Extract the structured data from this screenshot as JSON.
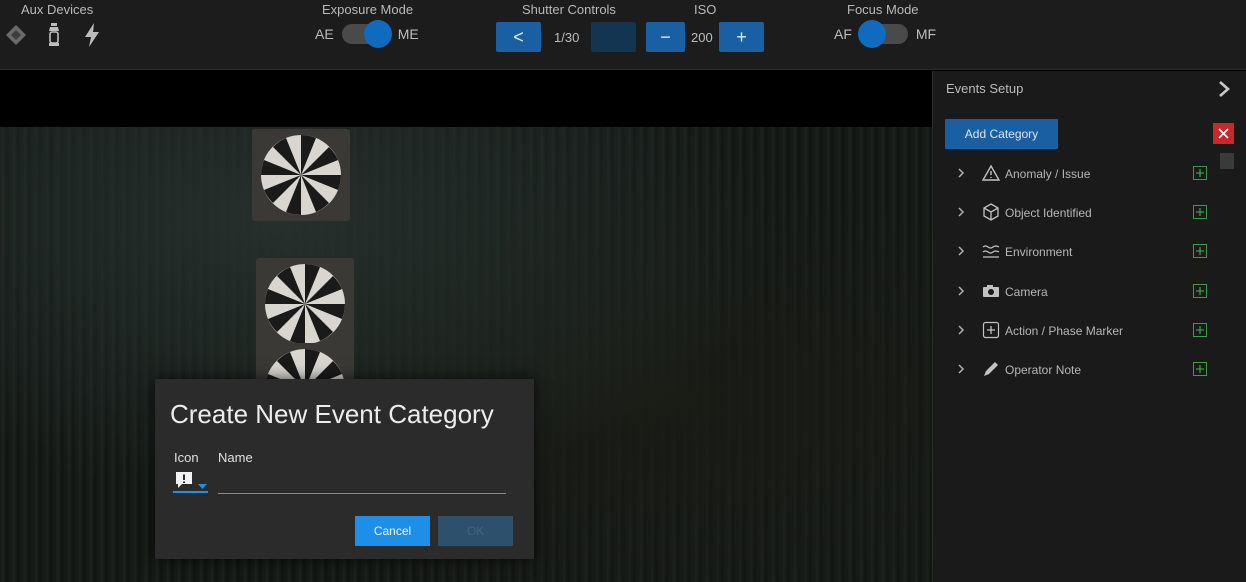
{
  "toolbar": {
    "aux_devices_label": "Aux Devices",
    "aux_icons": [
      "diamond-icon",
      "lantern-icon",
      "flash-icon"
    ],
    "exposure_mode": {
      "label": "Exposure Mode",
      "left": "AE",
      "right": "ME",
      "selected": "ME"
    },
    "shutter": {
      "label": "Shutter Controls",
      "prev": "<",
      "value": "1/30"
    },
    "iso": {
      "label": "ISO",
      "minus": "−",
      "value": "200",
      "plus": "+"
    },
    "focus_mode": {
      "label": "Focus Mode",
      "left": "AF",
      "right": "MF",
      "selected": "AF"
    }
  },
  "panel": {
    "title": "Events Setup",
    "add_category": "Add Category",
    "categories": [
      {
        "label": "Anomaly / Issue",
        "icon": "warning-triangle-icon"
      },
      {
        "label": "Object Identified",
        "icon": "cube-icon"
      },
      {
        "label": "Environment",
        "icon": "waves-icon"
      },
      {
        "label": "Camera",
        "icon": "camera-icon"
      },
      {
        "label": "Action / Phase Marker",
        "icon": "plus-box-icon"
      },
      {
        "label": "Operator Note",
        "icon": "pencil-icon"
      }
    ]
  },
  "dialog": {
    "title": "Create New Event Category",
    "icon_label": "Icon",
    "name_label": "Name",
    "name_value": "",
    "cancel": "Cancel",
    "ok": "OK"
  },
  "colors": {
    "accent": "#1b5fa3",
    "dialog_primary": "#1e8fe8",
    "close_red": "#c8282c",
    "add_green": "#3c9b46"
  }
}
